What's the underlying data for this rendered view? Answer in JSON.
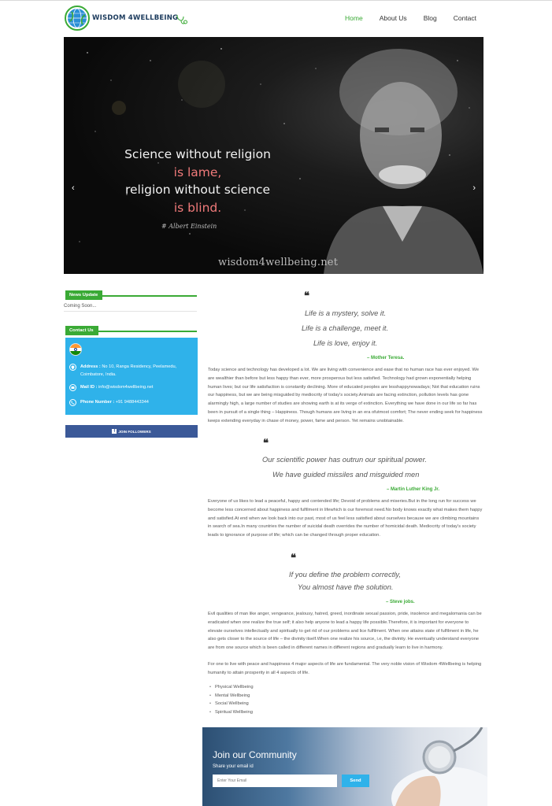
{
  "brand": {
    "name": "WISDOM 4WELLBEING"
  },
  "nav": [
    {
      "label": "Home",
      "active": true
    },
    {
      "label": "About Us"
    },
    {
      "label": "Blog"
    },
    {
      "label": "Contact"
    }
  ],
  "hero": {
    "prev": "‹",
    "next": "›",
    "lines": [
      "Science without religion",
      "is lame,",
      "religion without science",
      "is blind."
    ],
    "attribution": "# Albert Einstein",
    "watermark": "wisdom4wellbeing.net"
  },
  "sidebar": {
    "news_title": "News Update",
    "news_text": "Coming Soon...",
    "contact_title": "Contact Us",
    "address_label": "Address :",
    "address_value": "No 10, Ranga Residency, Peelamedu, Coimbatore, India.",
    "mail_label": "Mail ID :",
    "mail_value": "info@wisdom4wellbeing.net",
    "phone_label": "Phone Number :",
    "phone_value": "+91 9488443344",
    "fb_icon": "f",
    "fb_label": "JOIN FOLLOWERS"
  },
  "quotes": [
    {
      "mark": "❝",
      "lines": [
        "Life is a mystery, solve it.",
        "Life is a challenge, meet it.",
        "Life is love, enjoy it."
      ],
      "author": "– Mother Teresa."
    },
    {
      "mark": "❝",
      "lines": [
        "Our scientific power has outrun our spiritual power.",
        "We have guided missiles and misguided men"
      ],
      "author": "– Martin Luther King Jr."
    },
    {
      "mark": "❝",
      "lines": [
        "If you define the problem correctly,",
        "You almost have the solution."
      ],
      "author": "– Steve jobs."
    }
  ],
  "paragraphs": [
    "Today science and technology has developed a lot. We are living with convenience and ease that no human race has ever enjoyed. We are wealthier than before but less happy than ever, more prosperous but less satisfied. Technology had grown exponentially helping human lives; but our life satisfaction is constantly declining. More of educated peoples are lesshappynowadays; Not that education ruins our happiness, but we are being misguided by mediocrity of today's society.Animals are facing extinction, pollution levels has gone alarmingly high, a large number of studies are showing earth is at its verge of extinction. Everything we have done in our life so far has been in pursuit of a single thing – Happiness. Though humans are living in an era ofutmost comfort; The never ending seek for happiness keeps extending everyday in chase of money, power, fame and person. Yet remains unobtainable.",
    "Everyone of us likes to lead a peaceful, happy and contended life; Devoid of problems and miseries.But in the long run for success we become less concerned about happiness and fulfilment in lifewhich is our foremost need.No body knows exactly what makes them happy and satisfied.At end when we look back into our past, most of us feel less satisfied about ourselves because we are climbing mountains in search of sea.In many countries the number of suicidal death overrides the number of homicidal death. Mediocrity of today's society leads to ignorance of purpose of life; which can be changed through proper education.",
    "Evil qualities of man like anger, vengeance, jealousy, hatred, greed, inordinate sexual passion, pride, insolence and megalomania can be eradicated when one realize the true self; it also help anyone to lead a happy life possible.Therefore, it is important for everyone to elevate ourselves intellectually and spiritually to get rid of our problems and lice fulfilment. When one attains state of fulfilment in life, he also gets closer to the source of life – the divinity itself.When one realize his source, i.e, the divinity. He eventually understand everyone are from one source which is been called in different names in different regions and gradually learn to live in harmony.",
    "For one to live with peace and happiness 4 major aspects of life are fundamental. The very noble vision of Wisdom 4Wellbeing is helping humanity to attain prosperity in all 4 aspects of life."
  ],
  "aspects": [
    "Physical Wellbeing",
    "Mental Wellbeing",
    "Social Wellbeing",
    "Spiritual Wellbeing"
  ],
  "community": {
    "title": "Join our Community",
    "subtitle": "Share your email id",
    "placeholder": "Enter Your Email",
    "button": "Send"
  }
}
